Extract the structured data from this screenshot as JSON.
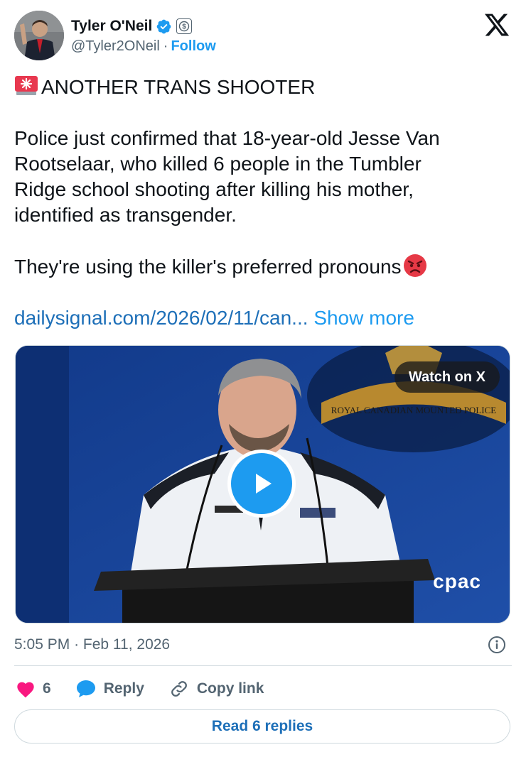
{
  "author": {
    "name": "Tyler O'Neil",
    "handle": "@Tyler2ONeil",
    "separator": "·",
    "follow_label": "Follow"
  },
  "tweet": {
    "headline": "ANOTHER TRANS SHOOTER",
    "body_lines": [
      "Police just confirmed that 18-year-old Jesse Van",
      "Rootselaar, who killed 6 people in the Tumbler",
      "Ridge school shooting after killing his mother,",
      "identified as transgender."
    ],
    "pronoun_line": "They're using the killer's preferred pronouns",
    "link_text": "dailysignal.com/2026/02/11/can...",
    "show_more_label": "Show more"
  },
  "media": {
    "watch_label": "Watch on X",
    "watermark": "cpac",
    "crest_text": "ROYAL CANADIAN MOUNTED POLICE"
  },
  "meta": {
    "time": "5:05 PM",
    "separator": "·",
    "date": "Feb 11, 2026"
  },
  "actions": {
    "like_count": "6",
    "reply_label": "Reply",
    "copy_link_label": "Copy link"
  },
  "read_replies_label": "Read 6 replies",
  "colors": {
    "accent": "#1d9bf0",
    "link": "#1d6fb8",
    "like": "#f91880",
    "muted": "#536471",
    "border": "#cfd9de"
  },
  "icons": [
    "verified-badge-icon",
    "subscription-dollar-icon",
    "x-logo-icon",
    "alarm-emoji-icon",
    "angry-emoji-icon",
    "play-icon",
    "info-icon",
    "heart-icon",
    "reply-bubble-icon",
    "link-icon"
  ]
}
